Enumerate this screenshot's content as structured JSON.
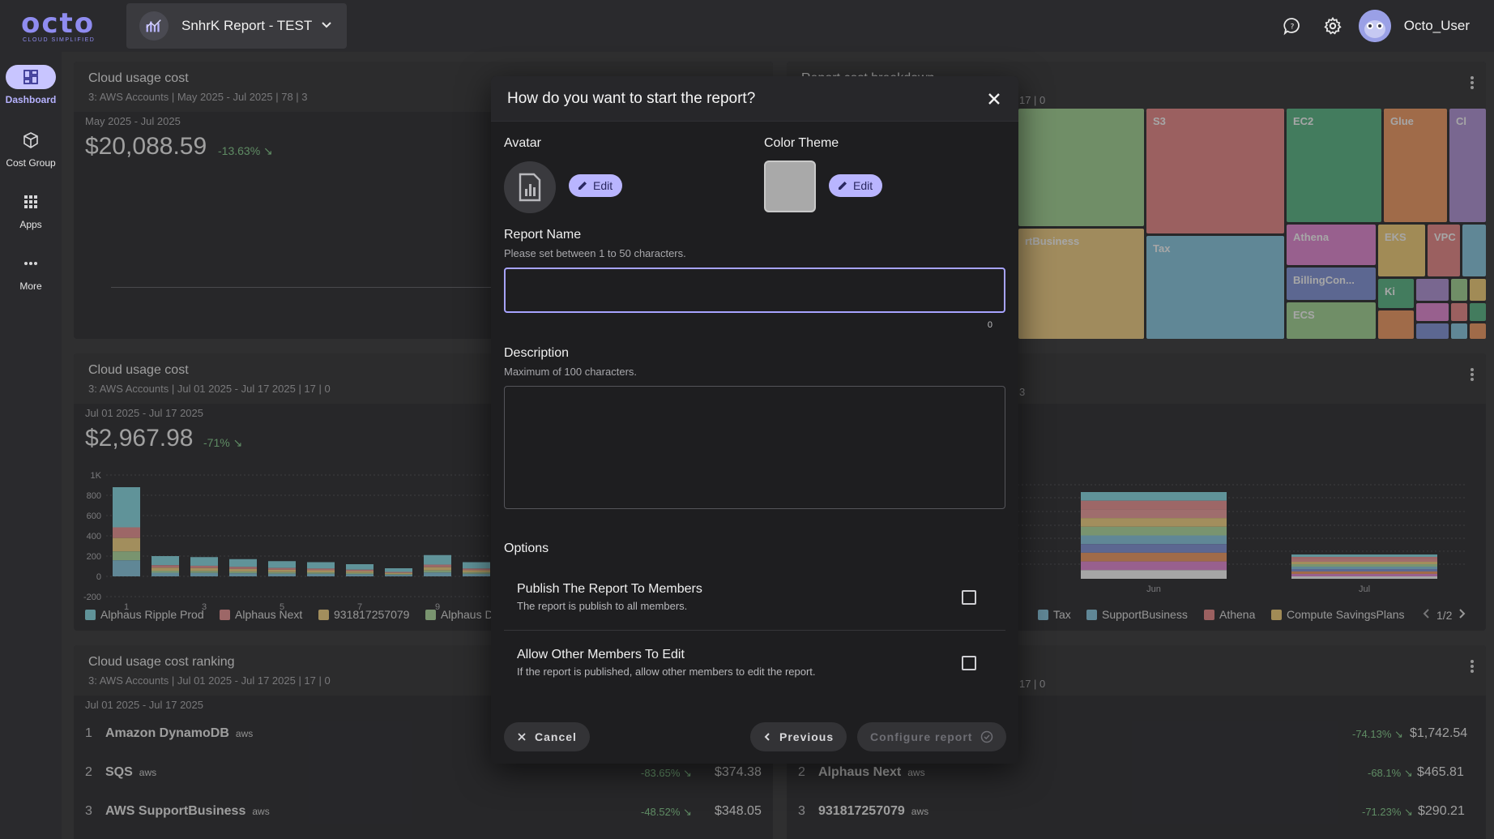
{
  "brand": {
    "logo_text": "octo",
    "tagline": "CLOUD SIMPLIFIED"
  },
  "header": {
    "report_name": "SnhrK Report - TEST",
    "username": "Octo_User"
  },
  "sidebar": {
    "items": [
      {
        "label": "Dashboard",
        "icon": "dashboard-icon",
        "active": true
      },
      {
        "label": "Cost Group",
        "icon": "cube-icon"
      },
      {
        "label": "Apps",
        "icon": "apps-grid-icon"
      },
      {
        "label": "More",
        "icon": "more-dots-icon"
      }
    ]
  },
  "cards": {
    "c1": {
      "title": "Cloud usage cost",
      "sub": "3: AWS Accounts | May 2025 - Jul 2025 | 78 | 3",
      "range": "May 2025 - Jul 2025",
      "total": "$20,088.59",
      "pct": "-13.63%"
    },
    "c2": {
      "title": "Report cost breakdown",
      "sub": "| 17 | 0"
    },
    "c3": {
      "title": "Cloud usage cost",
      "sub": "3: AWS Accounts | Jul 01 2025 - Jul 17 2025 | 17 | 0",
      "range": "Jul 01 2025 - Jul 17 2025",
      "total": "$2,967.98",
      "pct": "-71%"
    },
    "c4": {
      "sub": "| 3",
      "page": "1/2"
    },
    "c5": {
      "title": "Cloud usage cost ranking",
      "sub": "3: AWS Accounts | Jul 01 2025 - Jul 17 2025 | 17 | 0",
      "range": "Jul 01 2025 - Jul 17 2025"
    },
    "c6": {
      "sub": "| 17 | 0"
    }
  },
  "chart_data": {
    "type": "bar",
    "x_ticks": [
      "1",
      "3",
      "5",
      "7",
      "9"
    ],
    "y_ticks": [
      "1K",
      "800",
      "600",
      "400",
      "200",
      "0",
      "-200"
    ],
    "values": [
      880,
      200,
      190,
      170,
      150,
      140,
      120,
      80,
      210,
      140
    ],
    "ylim": [
      -200,
      1000
    ],
    "legend": [
      "Alphaus Ripple Prod",
      "Alphaus Next",
      "931817257079",
      "Alphaus D"
    ]
  },
  "chart2": {
    "x_ticks": [
      "Jun",
      "Jul"
    ],
    "legend": [
      "Tax",
      "SupportBusiness",
      "Athena",
      "Compute SavingsPlans"
    ]
  },
  "treemap": {
    "tiles": [
      "S3",
      "EC2",
      "Glue",
      "Cl",
      "rtBusiness",
      "Tax",
      "Athena",
      "EKS",
      "VPC",
      "BillingCon...",
      "Ki",
      "ECS"
    ]
  },
  "ranking_left": [
    {
      "rank": "1",
      "name": "Amazon DynamoDB",
      "badge": "aws",
      "pct": "",
      "value": ""
    },
    {
      "rank": "2",
      "name": "SQS",
      "badge": "aws",
      "pct": "-83.65%",
      "value": "$374.38"
    },
    {
      "rank": "3",
      "name": "AWS SupportBusiness",
      "badge": "aws",
      "pct": "-48.52%",
      "value": "$348.05"
    }
  ],
  "ranking_right": [
    {
      "rank": "",
      "name": "",
      "badge": "",
      "pct": "-74.13%",
      "value": "$1,742.54"
    },
    {
      "rank": "2",
      "name": "Alphaus Next",
      "badge": "aws",
      "pct": "-68.1%",
      "value": "$465.81"
    },
    {
      "rank": "3",
      "name": "931817257079",
      "badge": "aws",
      "pct": "-71.23%",
      "value": "$290.21"
    }
  ],
  "modal": {
    "title": "How do you want to start the report?",
    "avatar_label": "Avatar",
    "color_theme_label": "Color Theme",
    "edit_label": "Edit",
    "report_name_label": "Report Name",
    "report_name_help": "Please set between 1 to 50 characters.",
    "report_name_value": "",
    "report_name_count": "0",
    "description_label": "Description",
    "description_help": "Maximum of 100 characters.",
    "description_value": "",
    "options_label": "Options",
    "opt1_title": "Publish The Report To Members",
    "opt1_desc": "The report is publish to all members.",
    "opt2_title": "Allow Other Members To Edit",
    "opt2_desc": "If the report is published, allow other members to edit the report.",
    "cancel_label": "Cancel",
    "previous_label": "Previous",
    "configure_label": "Configure report",
    "swatch_color": "#a9a9a9",
    "accent": "#b9b5ff"
  }
}
